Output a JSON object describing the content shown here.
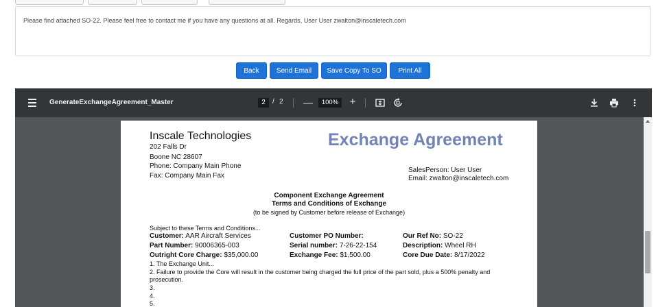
{
  "message": {
    "text": "Please find attached SO-22. Please feel free to contact me if you have any questions at all. Regards, User User zwalton@inscaletech.com"
  },
  "actions": {
    "back": "Back",
    "send_email": "Send Email",
    "save_copy": "Save Copy To SO",
    "print_all": "Print All"
  },
  "viewer": {
    "title": "GenerateExchangeAgreement_Master",
    "current_page": "2",
    "page_separator": "/",
    "total_pages": "2",
    "zoom_minus": "—",
    "zoom": "100%",
    "zoom_plus": "+",
    "icons": [
      "menu-icon",
      "fit-page-icon",
      "rotate-icon",
      "download-icon",
      "print-icon",
      "more-vert-icon"
    ]
  },
  "document": {
    "company": "Inscale Technologies",
    "address1": "202 Falls Dr",
    "address2": "Boone NC 28607",
    "phone": "Phone: Company Main Phone",
    "fax": "Fax: Company Main Fax",
    "title": "Exchange Agreement",
    "salesperson": "SalesPerson: User User",
    "email": "Email: zwalton@inscaletech.com",
    "agreement_title": "Component Exchange Agreement",
    "agreement_subtitle": "Terms and Conditions of Exchange",
    "agreement_note": "(to be signed by Customer before release of Exchange)",
    "subject": "Subject to these Terms and Conditions...",
    "fields": {
      "customer_label": "Customer:",
      "customer_value": "AAR Aircraft Services",
      "customer_po_label": "Customer PO Number:",
      "our_ref_label": "Our Ref No:",
      "our_ref_value": "SO-22",
      "part_label": "Part Number:",
      "part_value": "90006365-003",
      "serial_label": "Serial number:",
      "serial_value": "7-26-22-154",
      "desc_label": "Description:",
      "desc_value": "Wheel RH",
      "core_charge_label": "Outright Core Charge:",
      "core_charge_value": "$35,000.00",
      "fee_label": "Exchange Fee:",
      "fee_value": "$1,500.00",
      "due_label": "Core Due Date:",
      "due_value": "8/17/2022"
    },
    "terms": {
      "t1": "1.   The Exchange Unit...",
      "t2a": "2.   Failure to provide the Core will result in the customer being charged the full price of the part sold, plus a 500% penalty and",
      "t2b": "prosecution.",
      "t3": "3.",
      "t4": "4.",
      "t5": "5."
    }
  },
  "colors": {
    "primary_button": "#1f73d8",
    "viewer_toolbar": "#323639",
    "viewer_background": "#525659",
    "heading_blue": "#7283b5"
  }
}
